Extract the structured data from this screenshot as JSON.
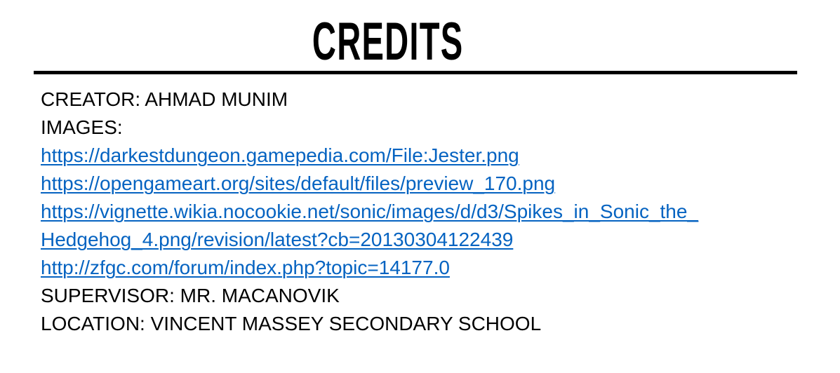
{
  "title": "CREDITS",
  "creator": "CREATOR: AHMAD MUNIM",
  "images_label": "IMAGES:",
  "links": [
    "https://darkestdungeon.gamepedia.com/File:Jester.png",
    "https://opengameart.org/sites/default/files/preview_170.png",
    "https://vignette.wikia.nocookie.net/sonic/images/d/d3/Spikes_in_Sonic_the_",
    "Hedgehog_4.png/revision/latest?cb=20130304122439",
    "http://zfgc.com/forum/index.php?topic=14177.0"
  ],
  "supervisor": "SUPERVISOR: MR. MACANOVIK",
  "location": "LOCATION: VINCENT MASSEY SECONDARY SCHOOL",
  "colors": {
    "link": "#0563c1",
    "text": "#000000",
    "background": "#ffffff"
  }
}
